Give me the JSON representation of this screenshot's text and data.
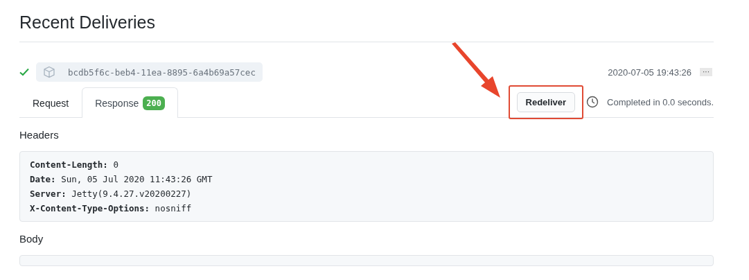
{
  "title": "Recent Deliveries",
  "delivery": {
    "succeeded": true,
    "guid": "bcdb5f6c-beb4-11ea-8895-6a4b69a57cec",
    "timestamp": "2020-07-05 19:43:26",
    "menu": "···"
  },
  "tabs": [
    {
      "label": "Request",
      "selected": false
    },
    {
      "label": "Response",
      "badge": "200",
      "color": "#4caf50",
      "selected": true
    }
  ],
  "redeliver": {
    "label": "Redeliver",
    "highlighted": true
  },
  "completed": "Completed in 0.0 seconds.",
  "headers": {
    "title": "Headers",
    "lines": [
      "**Content-Length:** 0",
      "**Date:** Sun, 05 Jul 2020 11:43:26 GMT",
      "**Server:** Jetty(9.4.27.v20200227)",
      "**X-Content-Type-Options:** nosniff"
    ]
  },
  "body": {
    "title": "Body"
  }
}
